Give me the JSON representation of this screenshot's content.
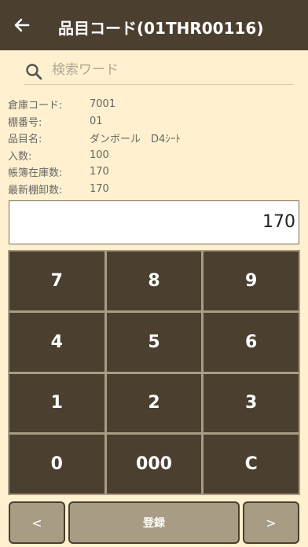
{
  "appbar": {
    "title": "品目コード(01THR00116)",
    "back_icon": "arrow-left-icon"
  },
  "search": {
    "placeholder": "検索ワード",
    "icon": "search-icon"
  },
  "info": [
    {
      "label": "倉庫コード:",
      "value": "7001"
    },
    {
      "label": "棚番号:",
      "value": "01"
    },
    {
      "label": "品目名:",
      "value": "ダンボール　D4ｼｰﾄ"
    },
    {
      "label": "入数:",
      "value": "100"
    },
    {
      "label": "帳簿在庫数:",
      "value": "170"
    },
    {
      "label": "最新棚卸数:",
      "value": "170"
    }
  ],
  "display": {
    "value": "170"
  },
  "keypad": [
    "7",
    "8",
    "9",
    "4",
    "5",
    "6",
    "1",
    "2",
    "3",
    "0",
    "000",
    "C"
  ],
  "footer": {
    "prev_label": "<",
    "register_label": "登録",
    "next_label": ">"
  },
  "colors": {
    "appbar_bg": "#4b3f30",
    "page_bg": "#fff1cf",
    "key_bg": "#4b3f30",
    "keypad_frame": "#a89c84"
  }
}
